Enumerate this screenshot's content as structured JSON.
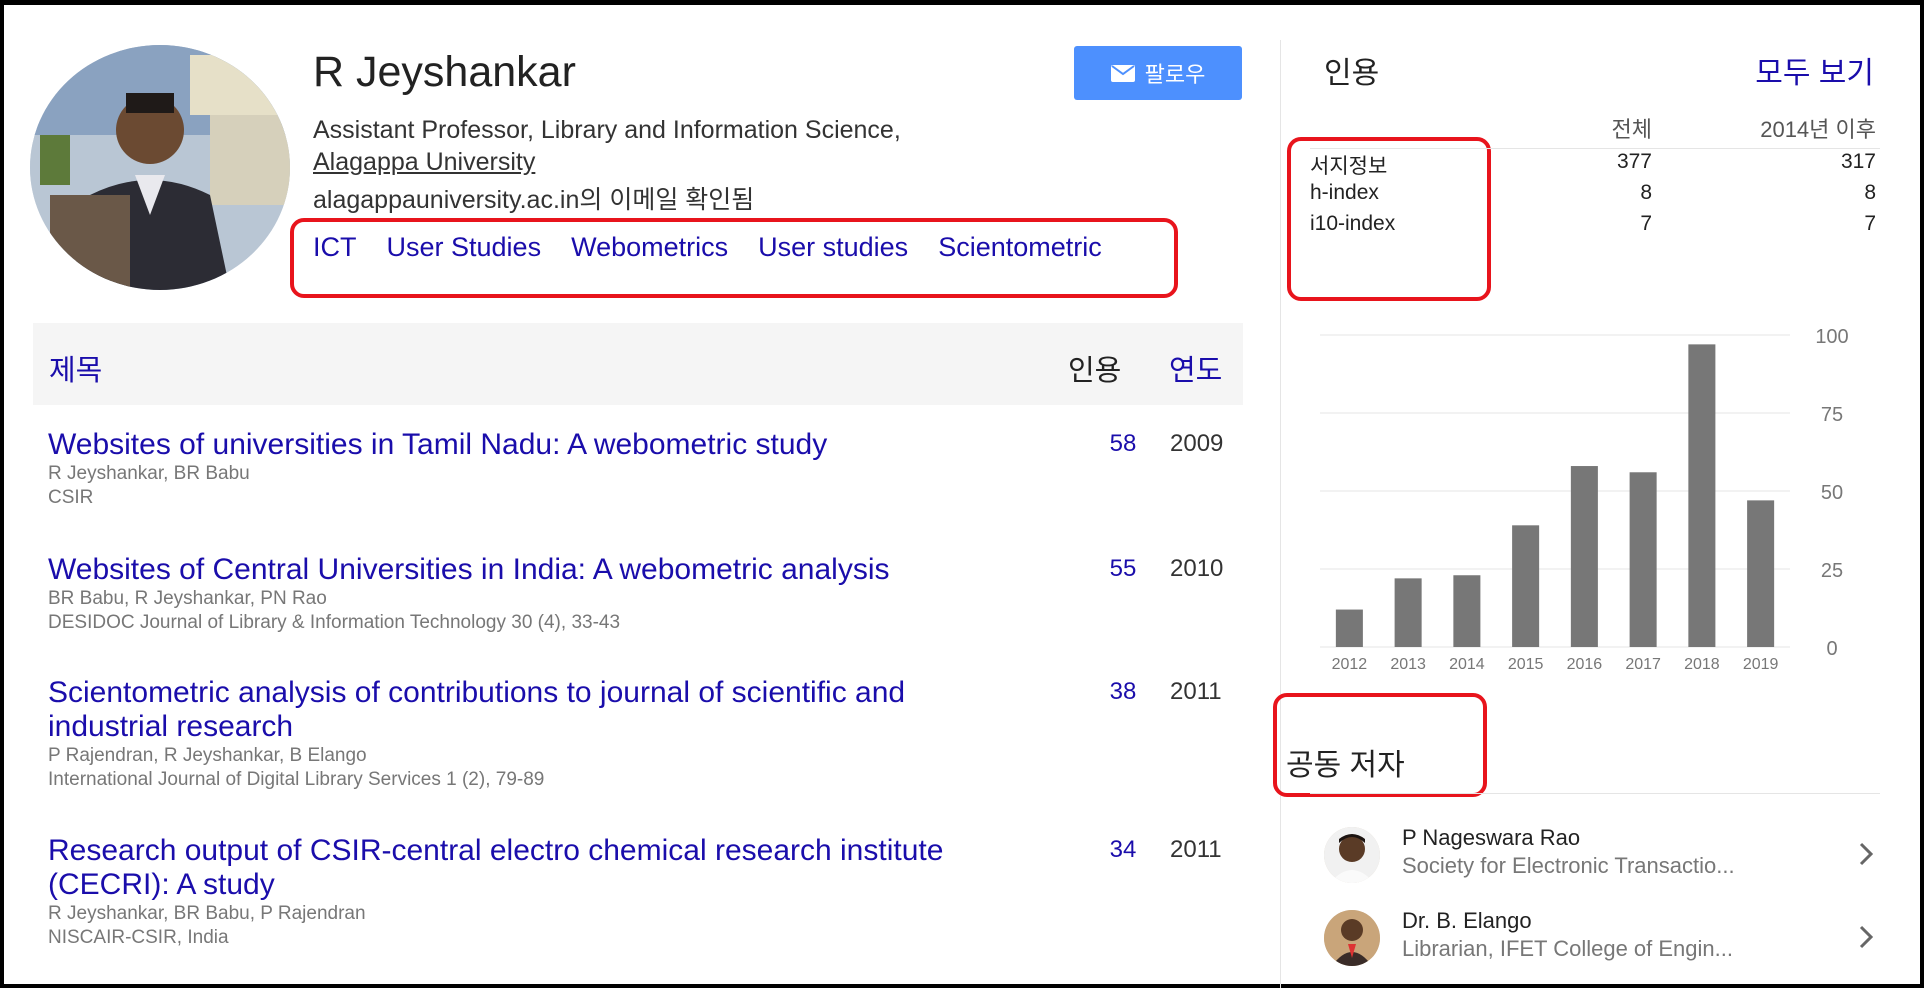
{
  "profile": {
    "name": "R Jeyshankar",
    "affiliation": "Assistant Professor, Library and Information Science,",
    "university": "Alagappa University",
    "verified_email": "alagappauniversity.ac.in의 이메일 확인됨",
    "interests": [
      "ICT",
      "User Studies",
      "Webometrics",
      "User studies",
      "Scientometric"
    ],
    "follow_label": "팔로우"
  },
  "articles_header": {
    "title": "제목",
    "cited_by": "인용",
    "year": "연도"
  },
  "articles": [
    {
      "title": "Websites of universities in Tamil Nadu: A webometric study",
      "authors": "R Jeyshankar, BR Babu",
      "venue": "CSIR",
      "cites": "58",
      "year": "2009"
    },
    {
      "title": "Websites of Central Universities in India: A webometric analysis",
      "authors": "BR Babu, R Jeyshankar, PN Rao",
      "venue": "DESIDOC Journal of Library & Information Technology 30 (4), 33-43",
      "cites": "55",
      "year": "2010"
    },
    {
      "title": "Scientometric analysis of contributions to journal of scientific and industrial research",
      "authors": "P Rajendran, R Jeyshankar, B Elango",
      "venue": "International Journal of Digital Library Services 1 (2), 79-89",
      "cites": "38",
      "year": "2011"
    },
    {
      "title": "Research output of CSIR-central electro chemical research institute (CECRI): A study",
      "authors": "R Jeyshankar, BR Babu, P Rajendran",
      "venue": "NISCAIR-CSIR, India",
      "cites": "34",
      "year": "2011"
    }
  ],
  "citations": {
    "heading": "인용",
    "view_all": "모두 보기",
    "col_all": "전체",
    "col_since": "2014년 이후",
    "rows": [
      {
        "label": "서지정보",
        "all": "377",
        "since": "317"
      },
      {
        "label": "h-index",
        "all": "8",
        "since": "8"
      },
      {
        "label": "i10-index",
        "all": "7",
        "since": "7"
      }
    ]
  },
  "chart_data": {
    "type": "bar",
    "categories": [
      "2012",
      "2013",
      "2014",
      "2015",
      "2016",
      "2017",
      "2018",
      "2019"
    ],
    "values": [
      12,
      22,
      23,
      39,
      58,
      56,
      97,
      47
    ],
    "ylim": [
      0,
      100
    ],
    "yticks": [
      0,
      25,
      50,
      75,
      100
    ],
    "grid": true,
    "bar_color": "#777777"
  },
  "coauthors": {
    "heading": "공동 저자",
    "items": [
      {
        "name": "P Nageswara Rao",
        "affiliation": "Society for Electronic Transactio..."
      },
      {
        "name": "Dr. B. Elango",
        "affiliation": "Librarian, IFET College of Engin..."
      }
    ]
  },
  "colors": {
    "link": "#1a0dab",
    "follow_button": "#4d90fe",
    "highlight_box": "#e8141c"
  },
  "icons": {
    "follow": "mail-icon",
    "coauthor_open": "chevron-right-icon"
  }
}
